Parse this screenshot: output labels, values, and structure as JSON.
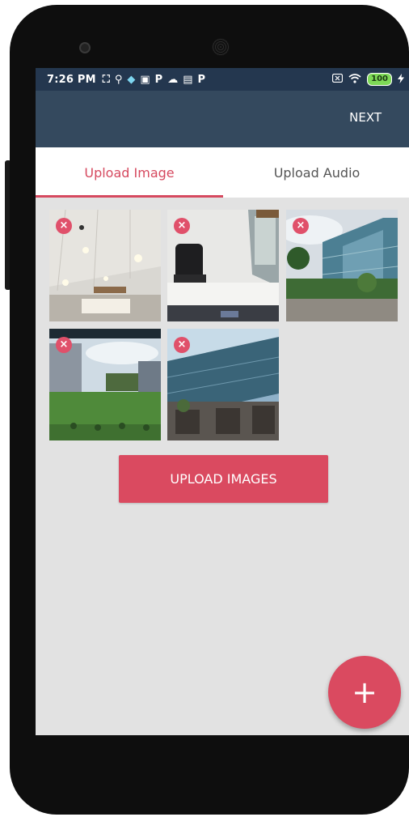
{
  "status_bar": {
    "time": "7:26 PM",
    "left_icons": [
      "image-icon",
      "location-pin-icon",
      "app-icon",
      "calendar-icon",
      "p-icon",
      "cloud-icon",
      "card-icon",
      "p-icon"
    ],
    "left_icon_glyphs": [
      "⛶",
      "⚲",
      "◆",
      "▣",
      "P",
      "☁",
      "▤",
      "P"
    ],
    "battery": "100",
    "right_icons": [
      "sim-icon",
      "wifi-icon",
      "battery-icon",
      "charging-icon"
    ]
  },
  "toolbar": {
    "next_label": "NEXT",
    "bg_color": "#34495e"
  },
  "tabs": [
    {
      "label": "Upload Image",
      "active": true
    },
    {
      "label": "Upload Audio",
      "active": false
    }
  ],
  "images": [
    {
      "name": "office-ceiling-photo",
      "remove_glyph": "×"
    },
    {
      "name": "office-desk-chair-photo",
      "remove_glyph": "×"
    },
    {
      "name": "glass-building-trees-photo",
      "remove_glyph": "×"
    },
    {
      "name": "lawn-buildings-photo",
      "remove_glyph": "×"
    },
    {
      "name": "glass-facade-photo",
      "remove_glyph": "×"
    }
  ],
  "upload_button": {
    "label": "UPLOAD IMAGES"
  },
  "fab": {
    "label": "+"
  },
  "colors": {
    "accent": "#da4a60",
    "screen_bg": "#e2e2e2",
    "status_bar": "#24374f"
  }
}
